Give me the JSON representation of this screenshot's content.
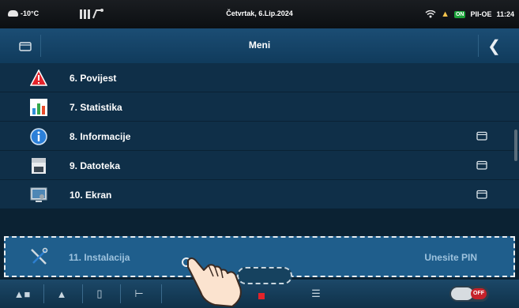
{
  "status_bar": {
    "temperature": "-10°C",
    "date": "Četvrtak, 6.Lip.2024",
    "on_badge": "ON",
    "mode": "PII-OE",
    "time": "11:24"
  },
  "header": {
    "title": "Meni"
  },
  "menu": {
    "items": [
      {
        "label": "6. Povijest",
        "icon": "warning-icon",
        "has_folder": false
      },
      {
        "label": "7. Statistika",
        "icon": "bar-chart-icon",
        "has_folder": false
      },
      {
        "label": "8. Informacije",
        "icon": "info-icon",
        "has_folder": true
      },
      {
        "label": "9. Datoteka",
        "icon": "file-icon",
        "has_folder": true
      },
      {
        "label": "10. Ekran",
        "icon": "screen-icon",
        "has_folder": true
      }
    ],
    "selected": {
      "label": "11. Instalacija",
      "action": "Unesite PIN",
      "icon": "tools-icon"
    }
  },
  "bottom_bar": {
    "toggle_label": "OFF"
  },
  "colors": {
    "row_bg": "#0f2f48",
    "selected_bg": "#1f5e8c",
    "header_bg": "#1b4d74",
    "accent_red": "#e2232a"
  }
}
